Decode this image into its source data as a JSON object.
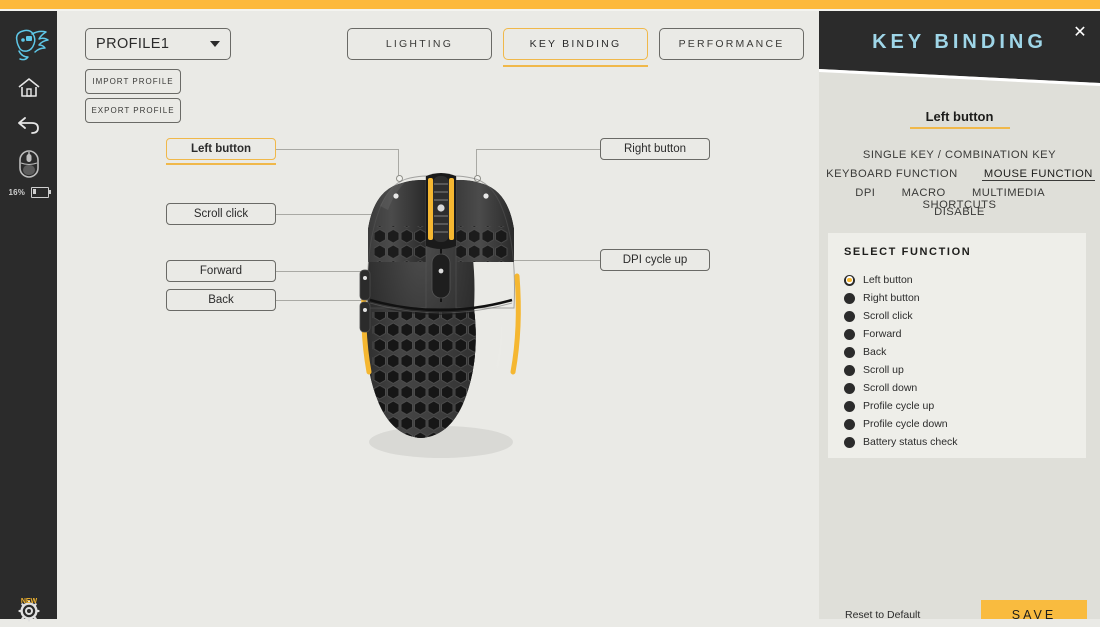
{
  "theme": {
    "accent_orange": "#fdb93c",
    "panel_bg": "#dfdfd9",
    "stage_bg": "#eaeae6",
    "dark": "#2b2b2b",
    "title_blue": "#9fd6e8"
  },
  "sidebar": {
    "logo_name": "pegasus-logo",
    "items": [
      {
        "name": "home-icon",
        "label": "Home"
      },
      {
        "name": "back-icon",
        "label": "Back"
      },
      {
        "name": "mouse-device-icon",
        "label": "Mouse"
      }
    ],
    "battery": {
      "percent": "16%"
    },
    "gear": {
      "badge": "NEW"
    }
  },
  "toolbar": {
    "profile_value": "PROFILE1",
    "import_label": "IMPORT PROFILE",
    "export_label": "EXPORT PROFILE"
  },
  "tabs": [
    {
      "label": "LIGHTING",
      "selected": false
    },
    {
      "label": "KEY BINDING",
      "selected": true
    },
    {
      "label": "PERFORMANCE",
      "selected": false
    }
  ],
  "callouts": {
    "left_button": "Left button",
    "scroll_click": "Scroll click",
    "forward": "Forward",
    "back": "Back",
    "right_button": "Right button",
    "dpi_cycle_up": "DPI cycle up"
  },
  "panel": {
    "title": "KEY BINDING",
    "close_glyph": "✕",
    "selected_button": "Left button",
    "function_rows": [
      [
        {
          "label": "SINGLE KEY / COMBINATION KEY",
          "selected": false
        }
      ],
      [
        {
          "label": "KEYBOARD FUNCTION",
          "selected": false
        },
        {
          "label": "MOUSE FUNCTION",
          "selected": true
        }
      ],
      [
        {
          "label": "DPI",
          "selected": false
        },
        {
          "label": "MACRO",
          "selected": false
        },
        {
          "label": "MULTIMEDIA",
          "selected": false
        },
        {
          "label": "SHORTCUTS",
          "selected": false
        }
      ],
      [
        {
          "label": "DISABLE",
          "selected": false
        }
      ]
    ],
    "select_function_title": "SELECT FUNCTION",
    "functions": [
      {
        "label": "Left button",
        "selected": true
      },
      {
        "label": "Right button",
        "selected": false
      },
      {
        "label": "Scroll click",
        "selected": false
      },
      {
        "label": "Forward",
        "selected": false
      },
      {
        "label": "Back",
        "selected": false
      },
      {
        "label": "Scroll up",
        "selected": false
      },
      {
        "label": "Scroll down",
        "selected": false
      },
      {
        "label": "Profile cycle up",
        "selected": false
      },
      {
        "label": "Profile cycle down",
        "selected": false
      },
      {
        "label": "Battery status check",
        "selected": false
      }
    ],
    "reset_label": "Reset to Default",
    "save_label": "SAVE"
  }
}
